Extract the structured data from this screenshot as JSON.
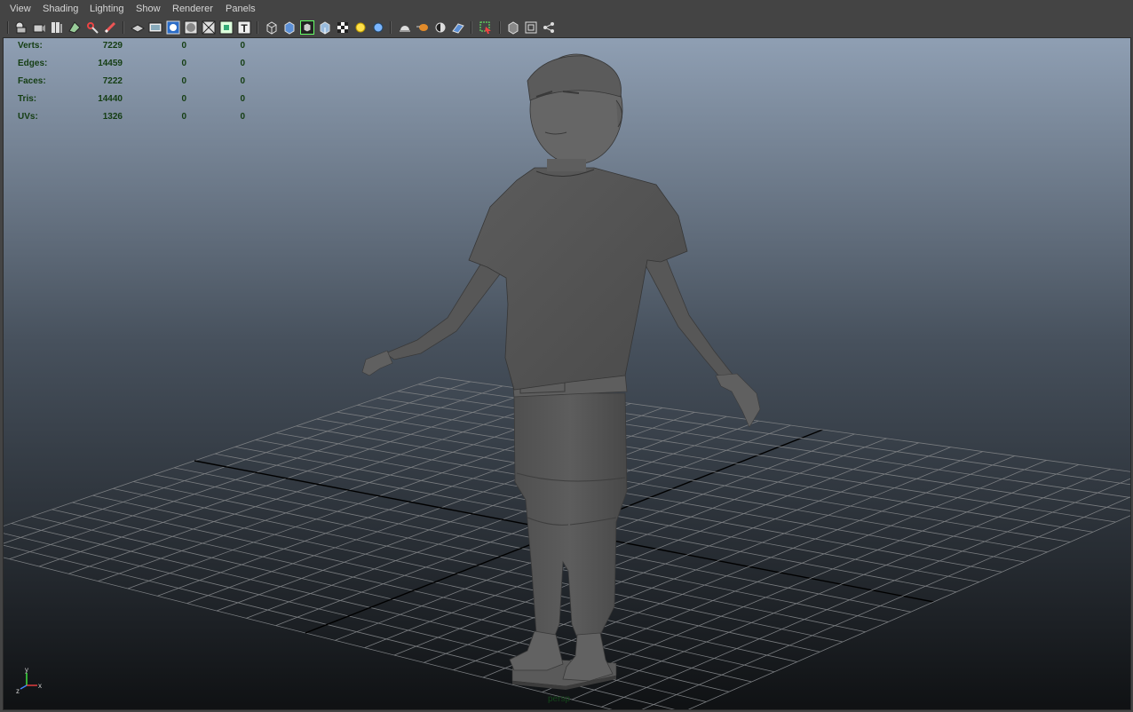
{
  "menu": {
    "items": [
      {
        "label": "View"
      },
      {
        "label": "Shading"
      },
      {
        "label": "Lighting"
      },
      {
        "label": "Show"
      },
      {
        "label": "Renderer"
      },
      {
        "label": "Panels"
      }
    ]
  },
  "toolbar": {
    "icons": [
      "select-camera-icon",
      "camera-attributes-icon",
      "bookmarks-icon",
      "image-plane-icon",
      "2d-pan-zoom-icon",
      "grease-pencil-icon",
      "grid-icon",
      "film-gate-icon",
      "resolution-gate-icon",
      "gate-mask-icon",
      "field-chart-icon",
      "safe-title-icon",
      "wireframe-icon",
      "smooth-shade-icon",
      "wireframe-on-shaded-icon",
      "textured-icon",
      "use-all-lights-icon",
      "default-material-icon",
      "shadows-icon",
      "screen-space-ao-icon",
      "motion-blur-icon",
      "multisample-aa-icon",
      "isolate-select-icon",
      "xray-icon",
      "xray-active-components-icon",
      "xray-joints-icon"
    ]
  },
  "hud": {
    "rows": [
      {
        "label": "Verts:",
        "v1": "7229",
        "v2": "0",
        "v3": "0"
      },
      {
        "label": "Edges:",
        "v1": "14459",
        "v2": "0",
        "v3": "0"
      },
      {
        "label": "Faces:",
        "v1": "7222",
        "v2": "0",
        "v3": "0"
      },
      {
        "label": "Tris:",
        "v1": "14440",
        "v2": "0",
        "v3": "0"
      },
      {
        "label": "UVs:",
        "v1": "1326",
        "v2": "0",
        "v3": "0"
      }
    ]
  },
  "viewport": {
    "camera": "persp",
    "axis": {
      "y": "y",
      "x": "x",
      "z": "z"
    }
  },
  "colors": {
    "background_top": "#8f9fb3",
    "background_bottom": "#121416",
    "grid_line": "#7a7d80",
    "grid_axis": "#000000",
    "hud_text": "#143d12",
    "model": "#6a6a6a"
  }
}
